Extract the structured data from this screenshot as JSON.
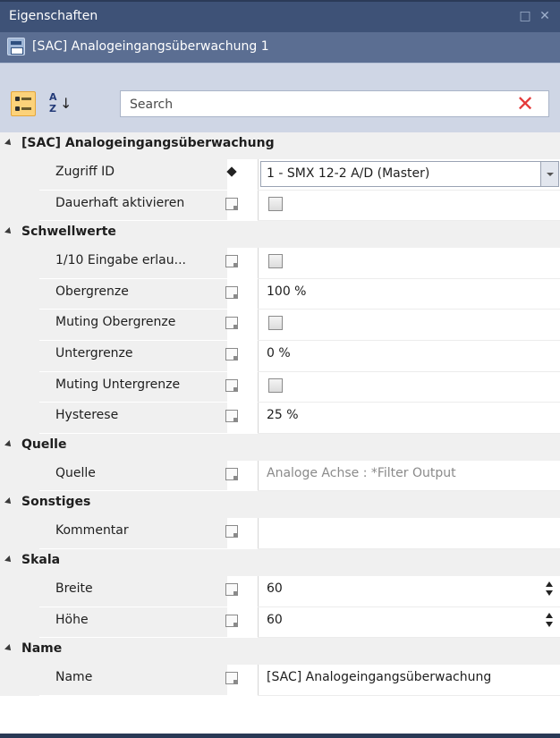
{
  "window": {
    "title": "Eigenschaften",
    "maximize_glyph": "□",
    "close_glyph": "✕"
  },
  "object": {
    "title": "[SAC] Analogeingangsüberwachung 1",
    "icon": "module-icon"
  },
  "toolbar": {
    "categorized_icon": "categorized-view-icon",
    "alphabetical_icon": "sort-alphabetical-icon",
    "search_placeholder": "Search",
    "search_value": "",
    "clear_glyph": "✕"
  },
  "categories": [
    {
      "label": "[SAC] Analogeingangsüberwachung",
      "properties": [
        {
          "name": "Zugriff ID",
          "marker": "diamond",
          "type": "dropdown",
          "value": "1 - SMX 12-2 A/D (Master)"
        },
        {
          "name": "Dauerhaft aktivieren",
          "marker": "box",
          "type": "checkbox",
          "checked": false
        }
      ]
    },
    {
      "label": "Schwellwerte",
      "properties": [
        {
          "name": "1/10 Eingabe erlau...",
          "marker": "box",
          "type": "checkbox",
          "checked": false
        },
        {
          "name": "Obergrenze",
          "marker": "box",
          "type": "text",
          "value": "100 %"
        },
        {
          "name": "Muting Obergrenze",
          "marker": "box",
          "type": "checkbox",
          "checked": false
        },
        {
          "name": "Untergrenze",
          "marker": "box",
          "type": "text",
          "value": "0 %"
        },
        {
          "name": "Muting Untergrenze",
          "marker": "box",
          "type": "checkbox",
          "checked": false
        },
        {
          "name": "Hysterese",
          "marker": "box",
          "type": "text",
          "value": "25 %"
        }
      ]
    },
    {
      "label": "Quelle",
      "properties": [
        {
          "name": "Quelle",
          "marker": "box",
          "type": "readonly",
          "value": "Analoge Achse : *Filter Output"
        }
      ]
    },
    {
      "label": "Sonstiges",
      "properties": [
        {
          "name": "Kommentar",
          "marker": "box",
          "type": "text",
          "value": ""
        }
      ]
    },
    {
      "label": "Skala",
      "properties": [
        {
          "name": "Breite",
          "marker": "box",
          "type": "spinner",
          "value": "60"
        },
        {
          "name": "Höhe",
          "marker": "box",
          "type": "spinner",
          "value": "60"
        }
      ]
    },
    {
      "label": "Name",
      "properties": [
        {
          "name": "Name",
          "marker": "box",
          "type": "text",
          "value": "[SAC] Analogeingangsüberwachung"
        }
      ]
    }
  ],
  "colors": {
    "title_bar": "#3e5277",
    "object_bar": "#5b6e92",
    "toolbar": "#cfd6e5",
    "category_bg": "#f0f0f0",
    "clear_icon": "#e43a3a",
    "category_toggle_active": "#fcd27a"
  }
}
